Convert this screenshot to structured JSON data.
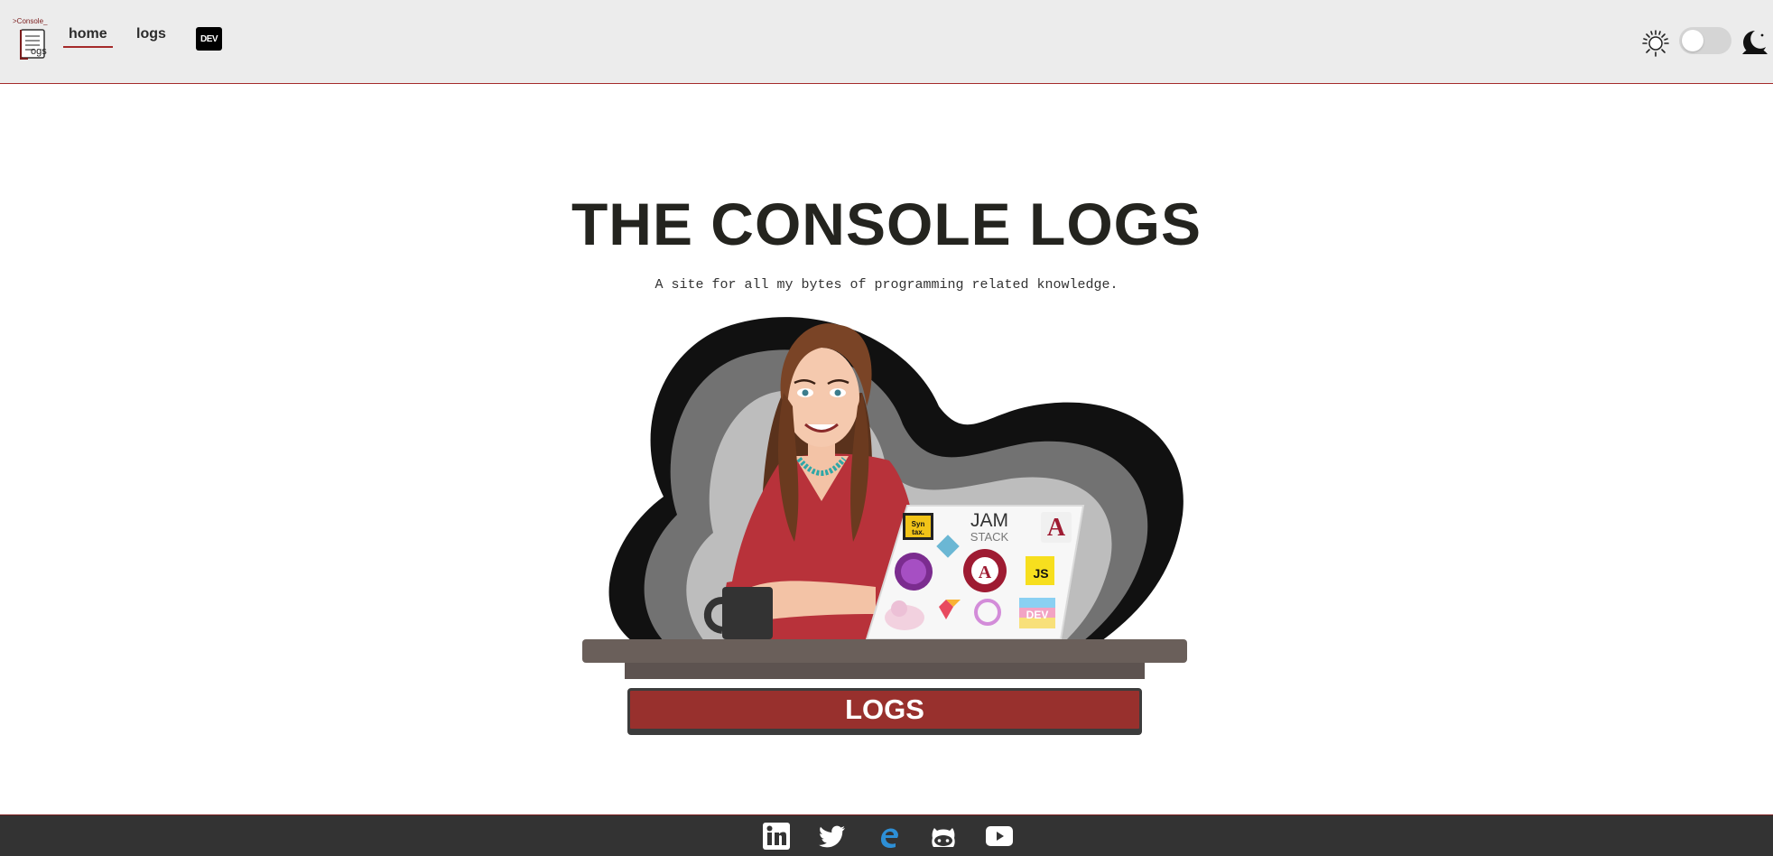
{
  "header": {
    "logo": {
      "top_text": ">Console_",
      "sub_text": "ogs"
    },
    "nav": [
      {
        "label": "home",
        "active": true
      },
      {
        "label": "logs",
        "active": false
      }
    ],
    "dev_badge": "DEV",
    "theme_toggle": {
      "state": "light"
    }
  },
  "hero": {
    "title": "THE CONSOLE LOGS",
    "tagline": "A site for all my bytes of programming related knowledge.",
    "button_label": "LOGS",
    "laptop_stickers": [
      "Syn tax.",
      "JAM",
      "STACK",
      "JS",
      "DEV"
    ]
  },
  "footer": {
    "social_icons": [
      "linkedin-icon",
      "twitter-icon",
      "edge-icon",
      "github-icon",
      "youtube-icon"
    ]
  },
  "colors": {
    "accent": "#a52a2a",
    "button": "#98302d",
    "header_bg": "#ececec",
    "footer_bg": "#333333",
    "title": "#24241f"
  }
}
